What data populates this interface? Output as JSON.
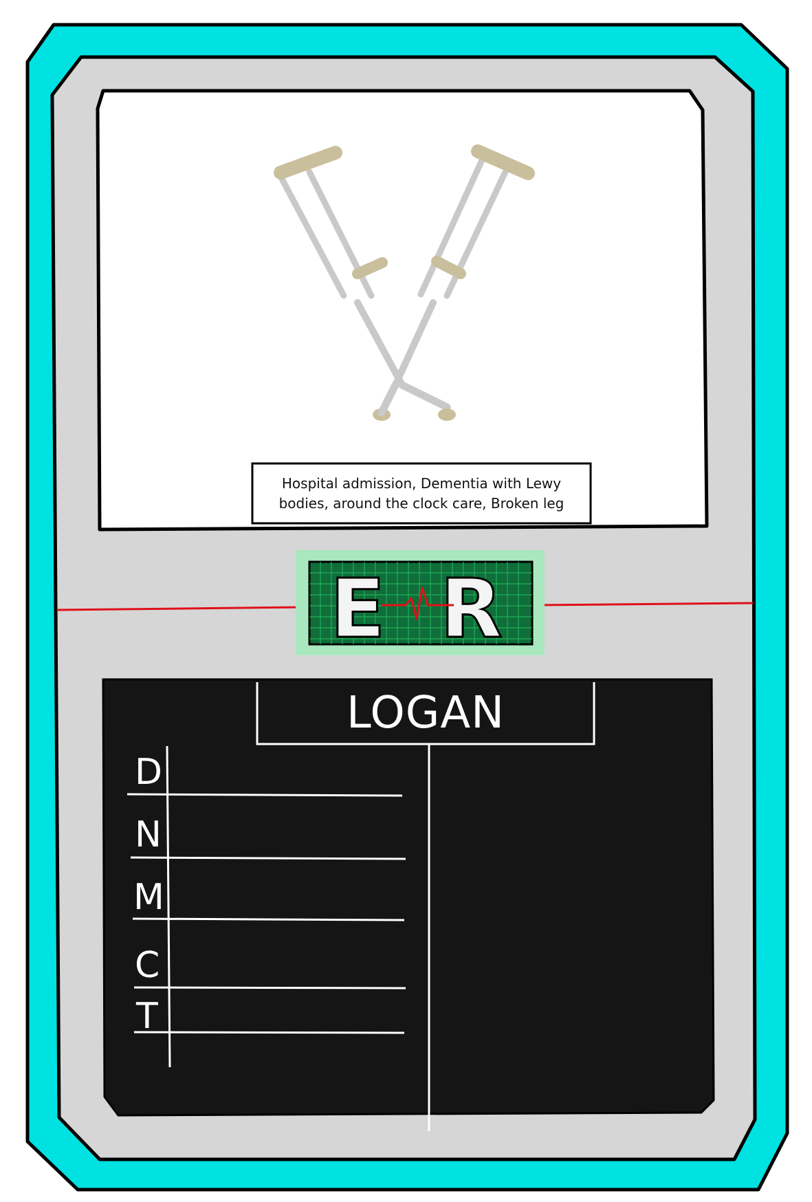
{
  "card": {
    "caption": "Hospital admission, Dementia with Lewy bodies, around the clock care, Broken leg",
    "name": "LOGAN",
    "logo": {
      "letters": [
        "E",
        "R"
      ]
    },
    "stats": [
      {
        "letter": "D"
      },
      {
        "letter": "N"
      },
      {
        "letter": "M"
      },
      {
        "letter": "C"
      },
      {
        "letter": "T"
      }
    ],
    "illustration": "crossed-crutches"
  },
  "colors": {
    "outer_border": "#00e1e1",
    "inner_panel": "#d6d6d6",
    "stat_panel": "#151515",
    "logo_green": "#0f6e3a",
    "ecg_red": "#e0101a"
  }
}
